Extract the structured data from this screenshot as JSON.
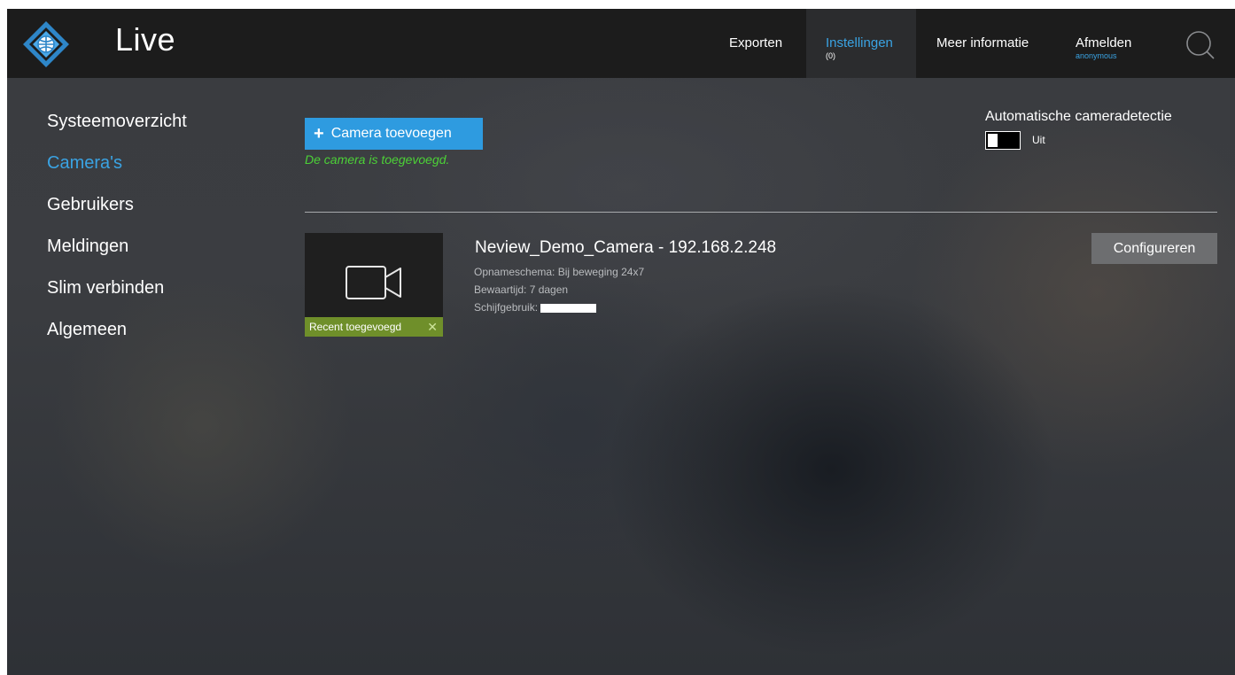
{
  "header": {
    "title": "Live",
    "nav": {
      "exporten": "Exporten",
      "instellingen": "Instellingen",
      "instellingen_count": "(0)",
      "meer_informatie": "Meer informatie",
      "afmelden": "Afmelden",
      "user": "anonymous"
    }
  },
  "sidebar": {
    "items": [
      {
        "label": "Systeemoverzicht"
      },
      {
        "label": "Camera's"
      },
      {
        "label": "Gebruikers"
      },
      {
        "label": "Meldingen"
      },
      {
        "label": "Slim verbinden"
      },
      {
        "label": "Algemeen"
      }
    ],
    "active": "Camera's"
  },
  "main": {
    "add_button": "Camera toevoegen",
    "success_message": "De camera is toegevoegd.",
    "auto_detect": {
      "label": "Automatische cameradetectie",
      "state": "Uit"
    },
    "camera": {
      "title": "Neview_Demo_Camera - 192.168.2.248",
      "schedule": "Opnameschema: Bij beweging 24x7",
      "retention": "Bewaartijd: 7 dagen",
      "disk_label": "Schijfgebruik:",
      "badge": "Recent toegevoegd",
      "configure_button": "Configureren"
    }
  },
  "colors": {
    "accent": "#3aa3e3",
    "add_button": "#2e9be0",
    "success": "#4cd137",
    "badge": "#6f8f2a"
  }
}
